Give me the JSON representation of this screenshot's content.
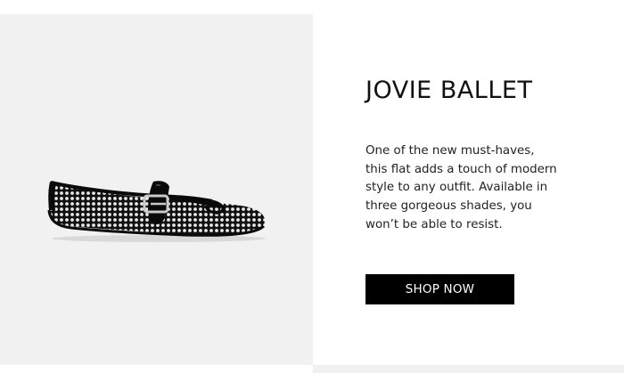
{
  "product": {
    "title": "JOVIE BALLET",
    "description_lines": [
      "One of the new must-haves,",
      "this flat adds a touch of modern",
      "style to any outfit. Available in",
      "three gorgeous shades, you",
      "won’t be able to resist."
    ],
    "cta_label": "SHOP NOW",
    "image_icon": "mesh-mary-jane-ballet-flat"
  },
  "colors": {
    "panel_bg": "#f1f1f1",
    "button_bg": "#000000",
    "button_text": "#ffffff",
    "title_text": "#111111"
  }
}
